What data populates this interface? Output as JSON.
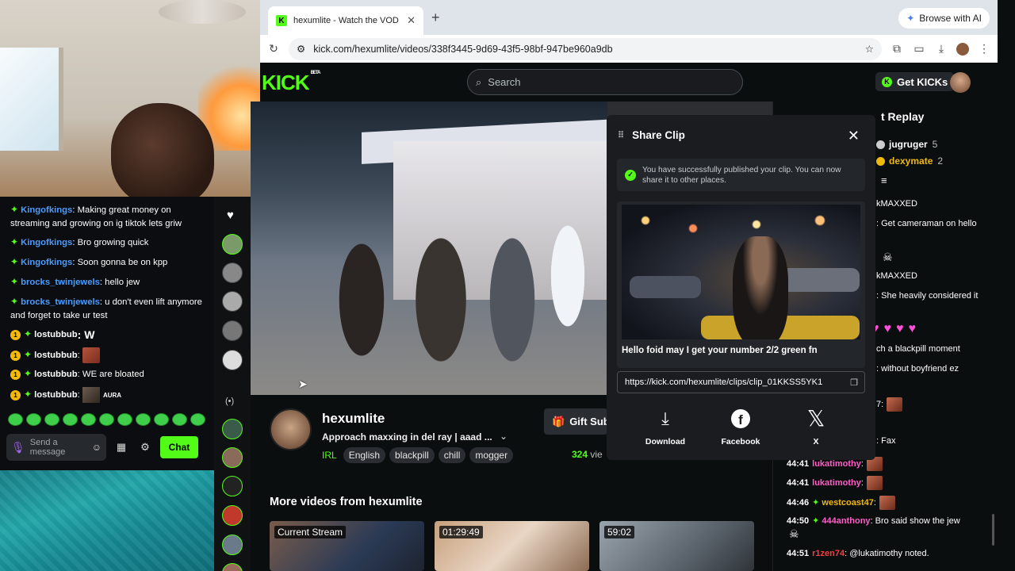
{
  "browser": {
    "tab_title": "hexumlite - Watch the VOD o",
    "favicon_letter": "K",
    "new_tab": "+",
    "ai_button": "Browse with AI",
    "url": "kick.com/hexumlite/videos/338f3445-9d69-43f5-98bf-947be960a9db"
  },
  "header": {
    "logo": "KICK",
    "logo_beta": "BETA",
    "search_placeholder": "Search",
    "get_kicks": "Get KICKs"
  },
  "left_chat": {
    "messages": [
      {
        "user": "Kingofkings",
        "text": ": Making great money on streaming and growing on ig tiktok lets griw"
      },
      {
        "user": "Kingofkings",
        "text": ": Bro growing quick"
      },
      {
        "user": "Kingofkings",
        "text": ": Soon gonna be on kpp"
      },
      {
        "user": "brocks_twinjewels",
        "text": ": hello jew"
      },
      {
        "user": "brocks_twinjewels",
        "text": ": u don't even lift anymore and forget to take ur test"
      },
      {
        "user": "lostubbub",
        "text": ": W"
      },
      {
        "user": "lostubbub",
        "text": ":"
      },
      {
        "user": "lostubbub",
        "text": ": WE are bloated"
      },
      {
        "user": "lostubbub",
        "text": ":"
      }
    ],
    "coin_value": "1",
    "aura_label": "AURA",
    "input_placeholder": "Send a message",
    "chat_button": "Chat"
  },
  "channel": {
    "name": "hexumlite",
    "title": "Approach maxxing in del ray | aaad ...",
    "category": "IRL",
    "tags": [
      "English",
      "blackpill",
      "chill",
      "mogger"
    ],
    "gift_button": "Gift Sub",
    "viewer_count": "324",
    "viewer_suffix": "vie"
  },
  "more_videos": {
    "heading": "More videos from hexumlite",
    "items": [
      {
        "label": "Current Stream"
      },
      {
        "label": "01:29:49"
      },
      {
        "label": "59:02"
      }
    ]
  },
  "replay_chat": {
    "title": "t Replay",
    "pinned": [
      {
        "user": "jugruger",
        "count": "5"
      },
      {
        "user": "dexymate",
        "count": "2"
      }
    ],
    "lines": [
      {
        "ts": "",
        "user": "",
        "text": "kMAXXED"
      },
      {
        "ts": "",
        "user": "",
        "text": ": Get cameraman on hello"
      },
      {
        "ts": "",
        "user": "",
        "text": "kMAXXED"
      },
      {
        "ts": "",
        "user": "",
        "text": ": She heavily considered it"
      },
      {
        "ts": "",
        "user": "",
        "text": "ch a blackpill moment"
      },
      {
        "ts": "",
        "user": "",
        "text": ": without boyfriend ez"
      },
      {
        "ts": "",
        "user": "",
        "text": "7:"
      },
      {
        "ts": "",
        "user": "",
        "text": ": Fax"
      },
      {
        "ts": "44:41",
        "user": "lukatimothy",
        "text": ":"
      },
      {
        "ts": "44:41",
        "user": "lukatimothy",
        "text": ":"
      },
      {
        "ts": "44:46",
        "user": "westcoast47",
        "text": ":"
      },
      {
        "ts": "44:50",
        "user": "444anthony",
        "text": ": Bro said show the jew"
      },
      {
        "ts": "44:51",
        "user": "r1zen74",
        "text": ": @lukatimothy noted."
      }
    ]
  },
  "share_clip": {
    "title": "Share Clip",
    "success_message": "You have successfully published your clip. You can now share it to other places.",
    "clip_title": "Hello foid may I get your number 2/2 green fn",
    "clip_url": "https://kick.com/hexumlite/clips/clip_01KKSS5YK1",
    "options": [
      {
        "label": "Download"
      },
      {
        "label": "Facebook"
      },
      {
        "label": "X"
      }
    ]
  },
  "colors": {
    "kick_green": "#53fc18",
    "username_blue": "#4b9cff",
    "gold": "#f0b90b"
  }
}
